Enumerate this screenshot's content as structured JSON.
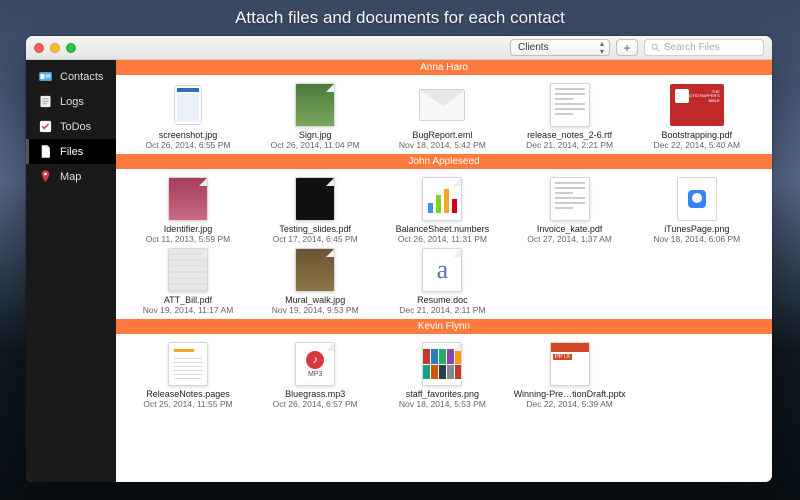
{
  "hero": {
    "title": "Attach files and documents for each contact"
  },
  "toolbar": {
    "category_selector": "Clients",
    "add_label": "+",
    "search_placeholder": "Search Files"
  },
  "sidebar": {
    "items": [
      {
        "label": "Contacts",
        "icon": "id-card-icon"
      },
      {
        "label": "Logs",
        "icon": "log-icon"
      },
      {
        "label": "ToDos",
        "icon": "checkbox-icon"
      },
      {
        "label": "Files",
        "icon": "document-icon"
      },
      {
        "label": "Map",
        "icon": "map-pin-icon"
      }
    ],
    "selected_index": 3
  },
  "sections": [
    {
      "title": "Anna Haro",
      "files": [
        {
          "name": "screenshot.jpg",
          "date": "Oct 26, 2014, 6:55 PM",
          "thumb": "screenshot"
        },
        {
          "name": "Sign.jpg",
          "date": "Oct 26, 2014, 11:04 PM",
          "thumb": "photo-green"
        },
        {
          "name": "BugReport.eml",
          "date": "Nov 18, 2014, 5:42 PM",
          "thumb": "envelope"
        },
        {
          "name": "release_notes_2-6.rtf",
          "date": "Dec 21, 2014, 2:21 PM",
          "thumb": "doclines"
        },
        {
          "name": "Bootstrapping.pdf",
          "date": "Dec 22, 2014, 5:40 AM",
          "thumb": "cover-red"
        }
      ]
    },
    {
      "title": "John Appleseed",
      "files": [
        {
          "name": "Identifier.jpg",
          "date": "Oct 11, 2013, 5:59 PM",
          "thumb": "photo-pink"
        },
        {
          "name": "Testing_slides.pdf",
          "date": "Oct 17, 2014, 6:45 PM",
          "thumb": "photo-dark"
        },
        {
          "name": "BalanceSheet.numbers",
          "date": "Oct 26, 2014, 11:31 PM",
          "thumb": "bars"
        },
        {
          "name": "Invoice_kate.pdf",
          "date": "Oct 27, 2014, 1:37 AM",
          "thumb": "doclines"
        },
        {
          "name": "iTunesPage.png",
          "date": "Nov 18, 2014, 6:06 PM",
          "thumb": "blueuser"
        },
        {
          "name": "ATT_Bill.pdf",
          "date": "Nov 19, 2014, 11:17 AM",
          "thumb": "photo-grey"
        },
        {
          "name": "Mural_walk.jpg",
          "date": "Nov 19, 2014, 9:53 PM",
          "thumb": "photo-brown"
        },
        {
          "name": "Resume.doc",
          "date": "Dec 21, 2014, 2:11 PM",
          "thumb": "a-letter"
        }
      ]
    },
    {
      "title": "Kevin Flynn",
      "files": [
        {
          "name": "ReleaseNotes.pages",
          "date": "Oct 25, 2014, 11:55 PM",
          "thumb": "pages"
        },
        {
          "name": "Bluegrass.mp3",
          "date": "Oct 26, 2014, 6:57 PM",
          "thumb": "mp3"
        },
        {
          "name": "staff_favorites.png",
          "date": "Nov 18, 2014, 5:53 PM",
          "thumb": "favstrip"
        },
        {
          "name": "Winning-Pre…tionDraft.pptx",
          "date": "Dec 22, 2014, 5:39 AM",
          "thumb": "pptx"
        }
      ]
    }
  ]
}
